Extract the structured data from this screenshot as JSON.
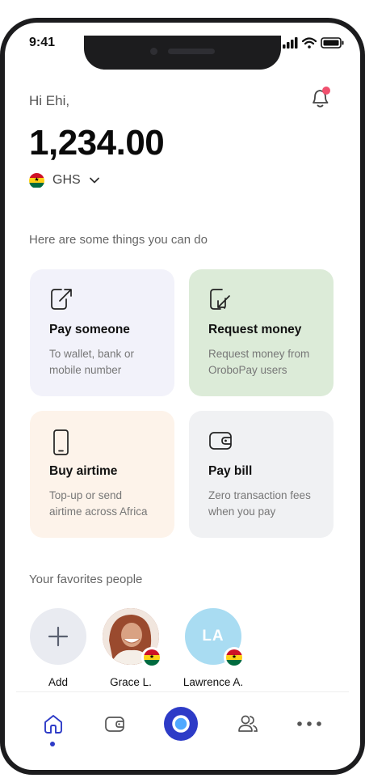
{
  "status_bar": {
    "time": "9:41"
  },
  "header": {
    "greeting": "Hi Ehi,",
    "balance": "1,234.00",
    "currency": "GHS"
  },
  "actions": {
    "title": "Here are some things you can do",
    "items": [
      {
        "title": "Pay someone",
        "subtitle_line1": "To wallet, bank or",
        "subtitle_line2": "mobile number",
        "icon": "send-arrow-icon"
      },
      {
        "title": "Request money",
        "subtitle_line1": "Request money from",
        "subtitle_line2": "OroboPay users",
        "icon": "receive-arrow-icon"
      },
      {
        "title": "Buy airtime",
        "subtitle_line1": "Top-up or send",
        "subtitle_line2": "airtime across Africa",
        "icon": "phone-icon"
      },
      {
        "title": "Pay bill",
        "subtitle_line1": "Zero transaction fees",
        "subtitle_line2": "when you pay",
        "icon": "wallet-icon"
      }
    ]
  },
  "favorites": {
    "title": "Your favorites people",
    "people": [
      {
        "name": "Add",
        "icon": "plus-icon"
      },
      {
        "name": "Grace L."
      },
      {
        "name": "Lawrence A.",
        "initials": "LA"
      }
    ]
  },
  "bottom_nav": {
    "items": [
      "home-icon",
      "wallet-icon",
      "center-action-icon",
      "contacts-icon",
      "more-icon"
    ],
    "active": "home-icon"
  },
  "colors": {
    "accent": "#2d3bc7",
    "card_pay": "#f2f2fa",
    "card_request": "#dcebd8",
    "card_airtime": "#fdf3ea",
    "card_bill": "#f0f1f3",
    "notification_dot": "#f0506e"
  }
}
